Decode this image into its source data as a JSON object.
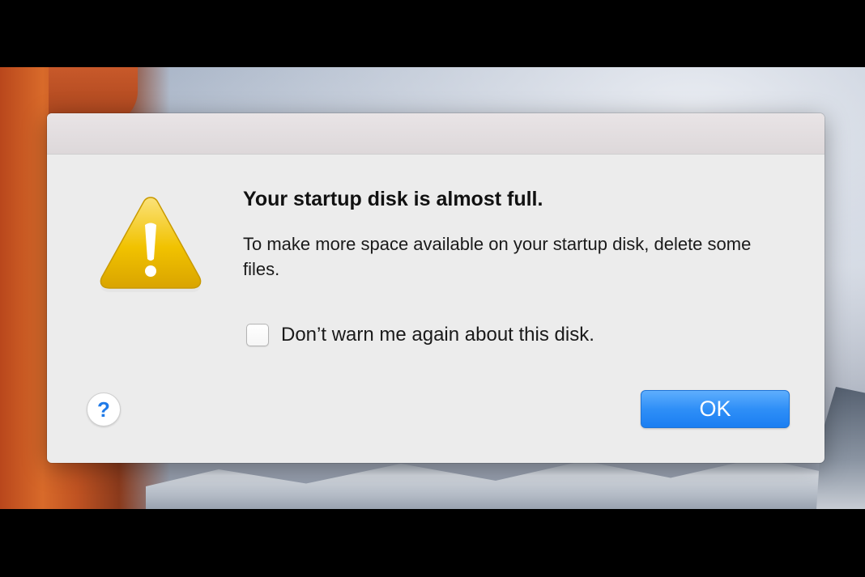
{
  "dialog": {
    "title": "Your startup disk is almost full.",
    "message": "To make more space available on your startup disk, delete some files.",
    "checkbox": {
      "label": "Don’t warn me again about this disk.",
      "checked": false
    },
    "help_button": {
      "label": "?",
      "icon": "help-icon"
    },
    "ok_button": {
      "label": "OK"
    },
    "alert_icon": "warning-triangle-icon"
  },
  "colors": {
    "accent": "#2f8ff7",
    "warning_yellow": "#f2c200",
    "dialog_background": "#ececec"
  }
}
